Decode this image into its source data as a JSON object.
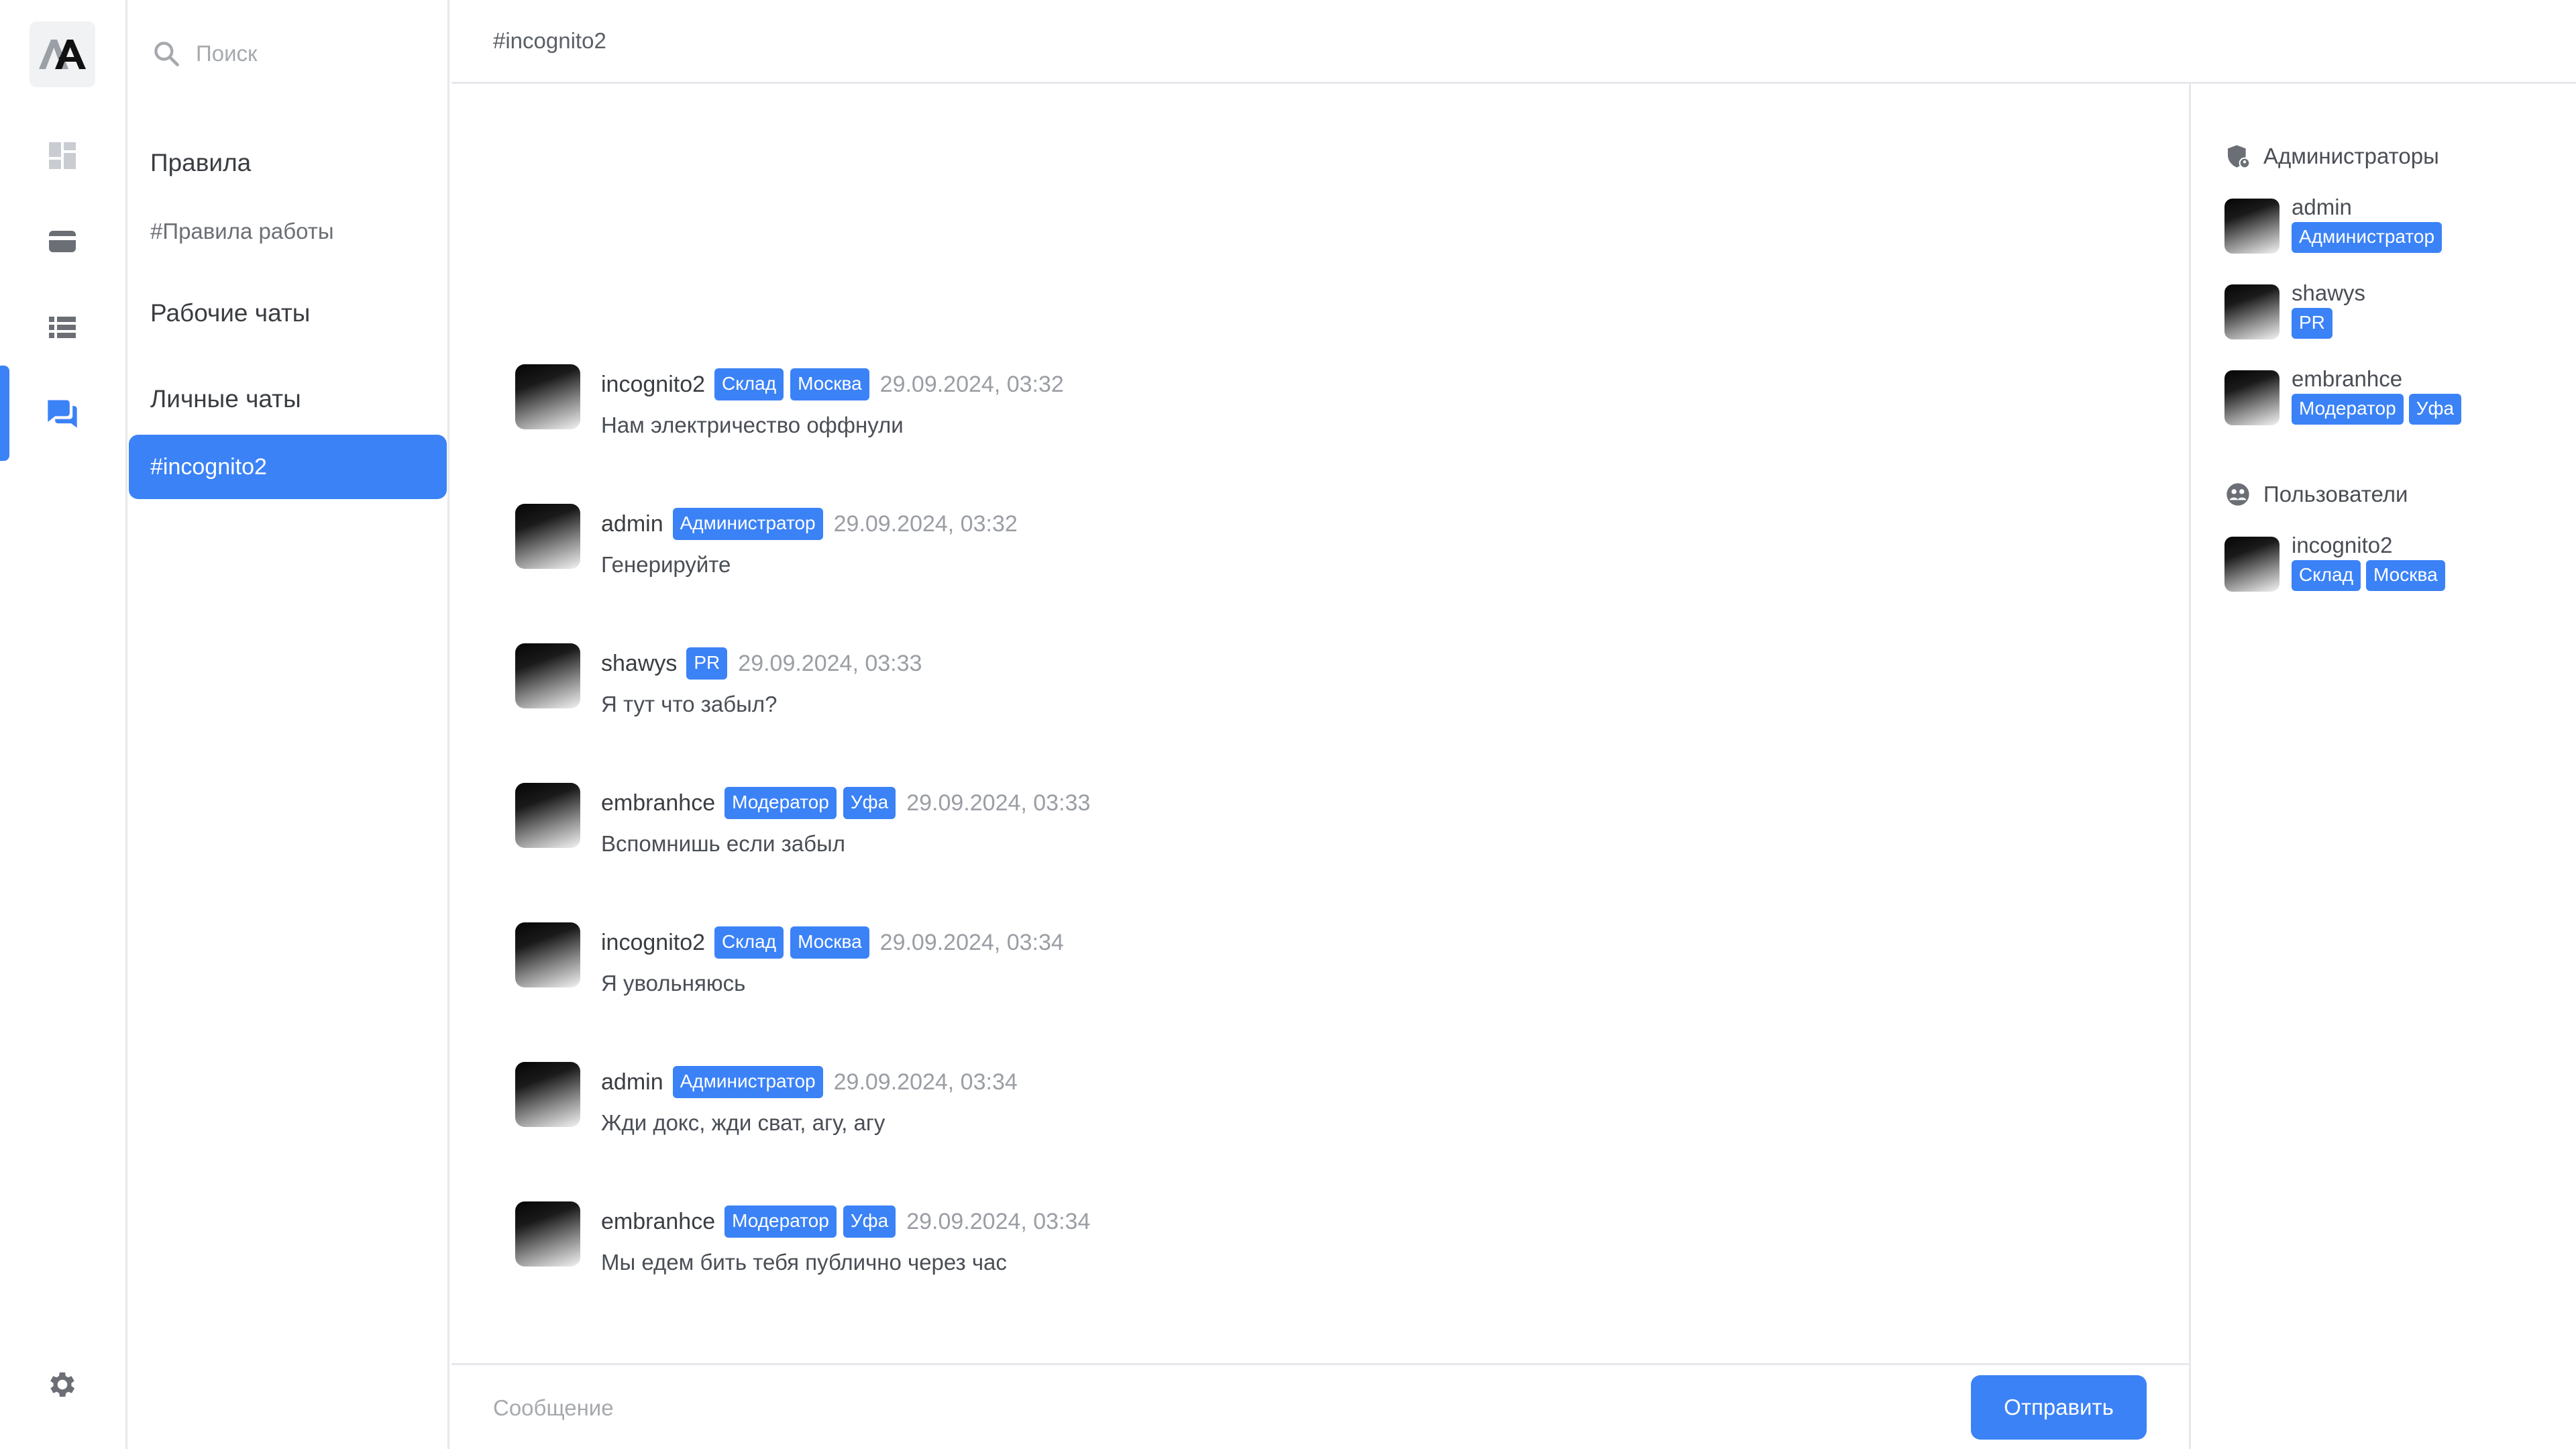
{
  "app": {
    "logo_text": "AA"
  },
  "rail": {
    "items": [
      {
        "icon": "dashboard-icon"
      },
      {
        "icon": "wallet-icon"
      },
      {
        "icon": "list-icon"
      },
      {
        "icon": "chat-icon",
        "active": true
      }
    ],
    "settings_icon": "gear-icon"
  },
  "channels": {
    "search_placeholder": "Поиск",
    "sections": [
      {
        "title": "Правила",
        "items": [
          "#Правила работы"
        ]
      },
      {
        "title": "Рабочие чаты",
        "items": []
      },
      {
        "title": "Личные чаты",
        "items": [
          "#incognito2"
        ]
      }
    ],
    "active": "#incognito2"
  },
  "chat": {
    "title": "#incognito2",
    "messages": [
      {
        "author": "incognito2",
        "badges": [
          "Склад",
          "Москва"
        ],
        "time": "29.09.2024, 03:32",
        "text": "Нам электричество оффнули"
      },
      {
        "author": "admin",
        "badges": [
          "Администратор"
        ],
        "time": "29.09.2024, 03:32",
        "text": "Генерируйте"
      },
      {
        "author": "shawys",
        "badges": [
          "PR"
        ],
        "time": "29.09.2024, 03:33",
        "text": "Я тут что забыл?"
      },
      {
        "author": "embranhce",
        "badges": [
          "Модератор",
          "Уфа"
        ],
        "time": "29.09.2024, 03:33",
        "text": "Вспомнишь если забыл"
      },
      {
        "author": "incognito2",
        "badges": [
          "Склад",
          "Москва"
        ],
        "time": "29.09.2024, 03:34",
        "text": "Я увольняюсь"
      },
      {
        "author": "admin",
        "badges": [
          "Администратор"
        ],
        "time": "29.09.2024, 03:34",
        "text": "Жди докс, жди сват, агу, агу"
      },
      {
        "author": "embranhce",
        "badges": [
          "Модератор",
          "Уфа"
        ],
        "time": "29.09.2024, 03:34",
        "text": "Мы едем бить тебя публично через час"
      }
    ],
    "composer": {
      "placeholder": "Сообщение",
      "send_label": "Отправить"
    }
  },
  "members": {
    "groups": [
      {
        "title": "Администраторы",
        "icon": "shield-user-icon",
        "members": [
          {
            "name": "admin",
            "badges": [
              "Администратор"
            ]
          },
          {
            "name": "shawys",
            "badges": [
              "PR"
            ]
          },
          {
            "name": "embranhce",
            "badges": [
              "Модератор",
              "Уфа"
            ]
          }
        ]
      },
      {
        "title": "Пользователи",
        "icon": "users-icon",
        "members": [
          {
            "name": "incognito2",
            "badges": [
              "Склад",
              "Москва"
            ]
          }
        ]
      }
    ]
  },
  "colors": {
    "accent": "#3b82f6",
    "border": "#e6e8ec",
    "icon": "#6b6f75"
  }
}
